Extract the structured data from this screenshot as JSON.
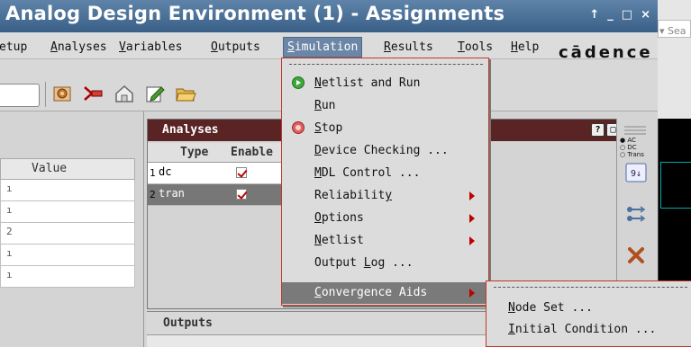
{
  "window": {
    "title": "Analog Design Environment (1) - Assignments",
    "controls": [
      "↑",
      "_",
      "□",
      "×"
    ]
  },
  "search": {
    "placeholder": "Sea"
  },
  "menubar": {
    "items": [
      {
        "pre": "",
        "u": "",
        "post": "etup"
      },
      {
        "pre": "",
        "u": "A",
        "post": "nalyses"
      },
      {
        "pre": "",
        "u": "V",
        "post": "ariables"
      },
      {
        "pre": "",
        "u": "O",
        "post": "utputs"
      },
      {
        "pre": "",
        "u": "S",
        "post": "imulation"
      },
      {
        "pre": "",
        "u": "R",
        "post": "esults"
      },
      {
        "pre": "",
        "u": "T",
        "post": "ools"
      },
      {
        "pre": "",
        "u": "H",
        "post": "elp"
      }
    ],
    "brand": "cādence"
  },
  "left_panel": {
    "column_header": "Value",
    "rows": [
      "ı",
      "ı",
      "2",
      "ı",
      "ı"
    ]
  },
  "analyses": {
    "title": "Analyses",
    "window_buttons": [
      "?",
      "□",
      "×"
    ],
    "headers": {
      "type": "Type",
      "enable": "Enable"
    },
    "rows": [
      {
        "num": "1",
        "type": "dc",
        "enabled": true,
        "selected": false
      },
      {
        "num": "2",
        "type": "tran",
        "enabled": true,
        "selected": true
      }
    ]
  },
  "radio_options": [
    "AC",
    "DC",
    "Trans"
  ],
  "outputs": {
    "title": "Outputs"
  },
  "simulation_menu": {
    "items": [
      {
        "pre": "",
        "u": "N",
        "post": "etlist and Run",
        "icon": "play-icon",
        "submenu": false,
        "highlight": false
      },
      {
        "pre": "",
        "u": "R",
        "post": "un",
        "icon": "",
        "submenu": false,
        "highlight": false
      },
      {
        "pre": "",
        "u": "S",
        "post": "top",
        "icon": "stop-icon",
        "submenu": false,
        "highlight": false
      },
      {
        "pre": "",
        "u": "D",
        "post": "evice Checking ...",
        "icon": "",
        "submenu": false,
        "highlight": false
      },
      {
        "pre": "",
        "u": "M",
        "post": "DL Control ...",
        "icon": "",
        "submenu": false,
        "highlight": false
      },
      {
        "pre": "Reliabilit",
        "u": "y",
        "post": "",
        "icon": "",
        "submenu": true,
        "highlight": false
      },
      {
        "pre": "",
        "u": "O",
        "post": "ptions",
        "icon": "",
        "submenu": true,
        "highlight": false
      },
      {
        "pre": "",
        "u": "N",
        "post": "etlist",
        "icon": "",
        "submenu": true,
        "highlight": false
      },
      {
        "pre": "Output ",
        "u": "L",
        "post": "og ...",
        "icon": "",
        "submenu": false,
        "highlight": false
      },
      {
        "pre": "",
        "u": "C",
        "post": "onvergence Aids",
        "icon": "",
        "submenu": true,
        "highlight": true
      }
    ]
  },
  "convergence_submenu": {
    "items": [
      {
        "pre": "",
        "u": "N",
        "post": "ode Set ..."
      },
      {
        "pre": "",
        "u": "I",
        "post": "nitial Condition ..."
      }
    ]
  },
  "colors": {
    "title_bar": "#3b6088",
    "analyses_title": "#5b2424",
    "menu_highlight": "#7a7a7a",
    "menu_border": "#c0392b",
    "check_red": "#c00000"
  }
}
